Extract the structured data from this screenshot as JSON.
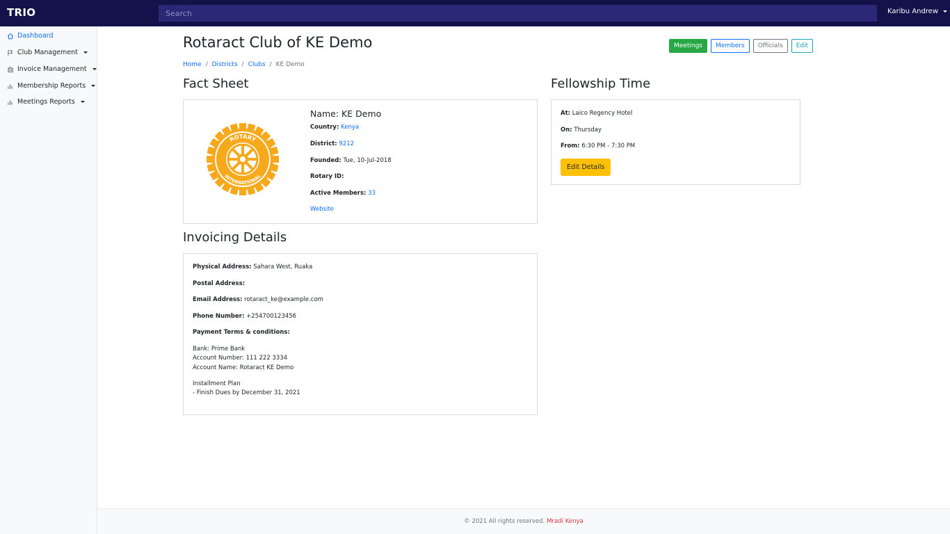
{
  "topbar": {
    "brand": "TRIO",
    "search_placeholder": "Search",
    "user_label": "Karibu Andrew"
  },
  "sidebar": {
    "items": [
      {
        "label": "Dashboard",
        "icon": "home-icon",
        "active": true
      },
      {
        "label": "Club Management",
        "icon": "flag-icon"
      },
      {
        "label": "Invoice Management",
        "icon": "building-icon"
      },
      {
        "label": "Membership Reports",
        "icon": "bar-chart-icon"
      },
      {
        "label": "Meetings Reports",
        "icon": "bar-chart-icon"
      }
    ]
  },
  "page": {
    "title": "Rotaract Club of KE Demo",
    "actions": {
      "meetings": "Meetings",
      "members": "Members",
      "officials": "Officials",
      "edit": "Edit"
    },
    "breadcrumb": {
      "home": "Home",
      "districts": "Districts",
      "clubs": "Clubs",
      "current": "KE Demo"
    }
  },
  "fact_sheet": {
    "title": "Fact Sheet",
    "logo_text_top": "ROTARY",
    "logo_text_bottom": "INTERNATIONAL",
    "name": "Name: KE Demo",
    "country_label": "Country:",
    "country_value": "Kenya",
    "district_label": "District:",
    "district_value": "9212",
    "founded_label": "Founded:",
    "founded_value": "Tue, 10-Jul-2018",
    "rotary_id_label": "Rotary ID:",
    "rotary_id_value": "",
    "active_members_label": "Active Members:",
    "active_members_value": "33",
    "website_link": "Website"
  },
  "fellowship": {
    "title": "Fellowship Time",
    "at_label": "At:",
    "at_value": "Laico Regency Hotel",
    "on_label": "On:",
    "on_value": "Thursday",
    "from_label": "From:",
    "from_value": "6:30 PM - 7:30 PM",
    "edit_button": "Edit Details"
  },
  "invoicing": {
    "title": "Invoicing Details",
    "physical_label": "Physical Address:",
    "physical_value": "Sahara West, Ruaka",
    "postal_label": "Postal Address:",
    "postal_value": "",
    "email_label": "Email Address:",
    "email_value": "rotaract_ke@example.com",
    "phone_label": "Phone Number:",
    "phone_value": "+254700123456",
    "terms_label": "Payment Terms & conditions:",
    "bank_line": "Bank: Prime Bank",
    "account_number_line": "Account Number: 111 222 3334",
    "account_name_line": "Account Name: Rotaract KE Demo",
    "installment_title": "Installment Plan",
    "installment_line": "- Finish Dues by December 31, 2021"
  },
  "footer": {
    "copyright": "© 2021 All rights reserved.",
    "company": "Mradi Kenya"
  },
  "colors": {
    "topbar": "#14124a",
    "search": "#2a2877",
    "accent": "#0d6efd",
    "rotary_gold": "#f7a81b",
    "warning": "#ffc107",
    "success": "#28a745"
  }
}
